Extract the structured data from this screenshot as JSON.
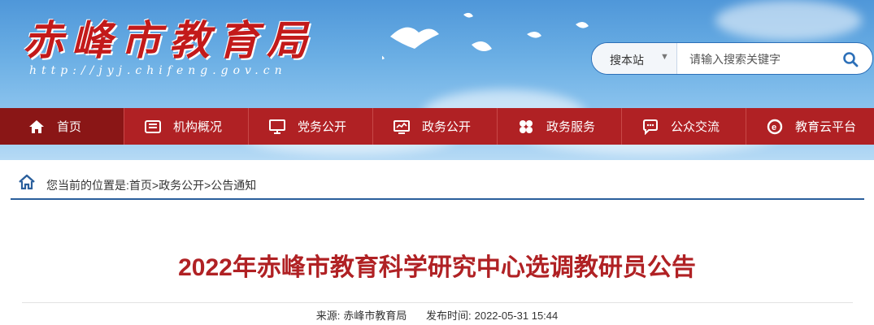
{
  "header": {
    "logo_text": "赤峰市教育局",
    "logo_url": "http://jyj.chifeng.gov.cn"
  },
  "search": {
    "scope_label": "搜本站",
    "placeholder": "请输入搜索关键字"
  },
  "nav": {
    "items": [
      {
        "label": "首页",
        "icon": "home-icon"
      },
      {
        "label": "机构概况",
        "icon": "building-icon"
      },
      {
        "label": "党务公开",
        "icon": "monitor-icon"
      },
      {
        "label": "政务公开",
        "icon": "screen-icon"
      },
      {
        "label": "政务服务",
        "icon": "grid-icon"
      },
      {
        "label": "公众交流",
        "icon": "chat-icon"
      },
      {
        "label": "教育云平台",
        "icon": "cloud-icon"
      }
    ]
  },
  "breadcrumb": {
    "text": "您当前的位置是:首页>政务公开>公告通知"
  },
  "article": {
    "title": "2022年赤峰市教育科学研究中心选调教研员公告",
    "source_label": "来源:",
    "source_value": "赤峰市教育局",
    "date_label": "发布时间:",
    "date_value": "2022-05-31 15:44"
  },
  "colors": {
    "nav_red": "#b02124",
    "nav_active": "#8a1616",
    "title_red": "#b02124",
    "accent_blue": "#2a5f9c"
  }
}
